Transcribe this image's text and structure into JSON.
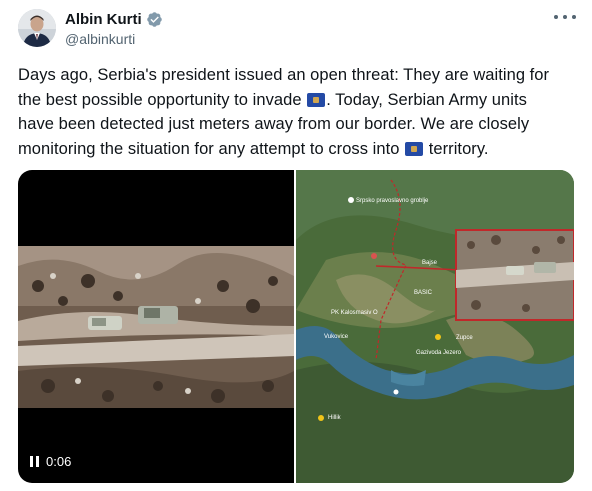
{
  "author": {
    "display_name": "Albin Kurti",
    "handle": "@albinkurti",
    "verified": true
  },
  "tweet": {
    "line1": "Days ago, Serbia's president issued an open threat: They are waiting for",
    "line2a": "the best possible opportunity to invade",
    "line2b": ". Today, Serbian Army units",
    "line3": "have been detected just meters away from our border. We are closely",
    "line4a": "monitoring the situation for any attempt to cross into",
    "line4b": "territory."
  },
  "media": {
    "video": {
      "duration": "0:06"
    },
    "map": {
      "place_label_top": "Srpsko pravoslavno groblje",
      "label_bajse": "Bajse",
      "label_basic": "BASIC",
      "label_pk": "PK Kalosmasiv O",
      "label_vukovice": "Vukovice",
      "label_jezero": "Gazivoda Jezero",
      "label_hilli": "Hillik",
      "label_zupce": "Zupce"
    }
  },
  "colors": {
    "text_primary": "#0f1419",
    "text_secondary": "#536471",
    "verified_badge": "#829aab",
    "flag_blue": "#244aa5",
    "flag_gold": "#d0a650",
    "border_line": "#c0282a",
    "lake": "#3b6f8a"
  }
}
